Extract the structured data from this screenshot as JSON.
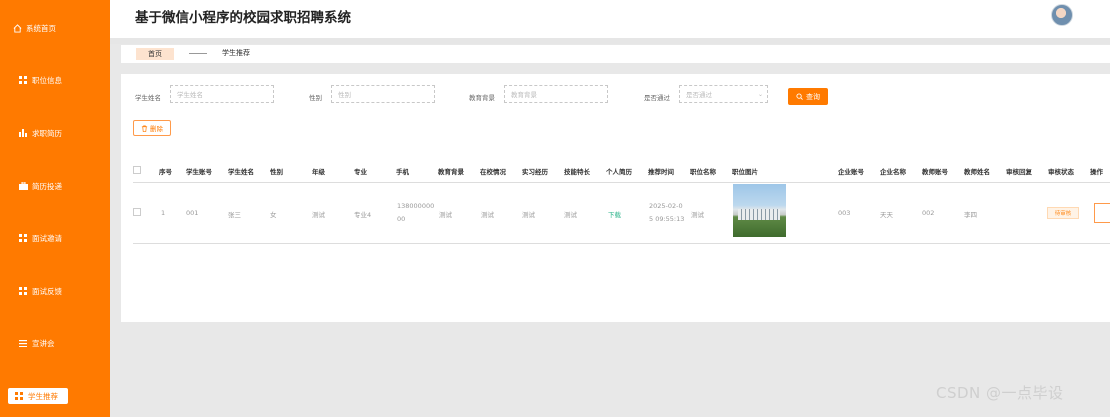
{
  "app": {
    "title": "基于微信小程序的校园求职招聘系统"
  },
  "sidebar": {
    "items": [
      {
        "label": "系统首页",
        "icon": "home-icon"
      },
      {
        "label": "职位信息",
        "icon": "grid-icon"
      },
      {
        "label": "求职简历",
        "icon": "bar-chart-icon"
      },
      {
        "label": "简历投递",
        "icon": "briefcase-icon"
      },
      {
        "label": "面试邀请",
        "icon": "grid-icon"
      },
      {
        "label": "面试反馈",
        "icon": "grid-icon"
      },
      {
        "label": "宣讲会",
        "icon": "list-icon"
      },
      {
        "label": "学生推荐",
        "icon": "grid-icon",
        "active": true
      }
    ]
  },
  "breadcrumb": {
    "home": "首页",
    "current": "学生推荐"
  },
  "search": {
    "fields": [
      {
        "label": "学生姓名",
        "placeholder": "学生姓名"
      },
      {
        "label": "性别",
        "placeholder": "性别"
      },
      {
        "label": "教育背景",
        "placeholder": "教育背景"
      },
      {
        "label": "是否通过",
        "placeholder": "是否通过"
      }
    ],
    "query_button": "查询",
    "delete_button": "删除"
  },
  "table": {
    "columns": [
      "序号",
      "学生账号",
      "学生姓名",
      "性别",
      "年级",
      "专业",
      "手机",
      "教育背景",
      "在校情况",
      "实习经历",
      "技能特长",
      "个人简历",
      "推荐时间",
      "职位名称",
      "职位图片",
      "企业账号",
      "企业名称",
      "教师账号",
      "教师姓名",
      "审核回复",
      "审核状态",
      "操作"
    ],
    "rows": [
      {
        "index": "1",
        "student_account": "001",
        "student_name": "张三",
        "gender": "女",
        "grade": "测试",
        "major": "专业4",
        "phone_l1": "138000000",
        "phone_l2": "00",
        "education": "测试",
        "campus": "测试",
        "internship": "测试",
        "skills": "测试",
        "resume": "下载",
        "time_l1": "2025-02-0",
        "time_l2": "5 09:55:13",
        "position": "测试",
        "company_account": "003",
        "company_name": "天天",
        "teacher_account": "002",
        "teacher_name": "李四",
        "review_reply": "",
        "review_status": "待审核"
      }
    ]
  },
  "watermark": "CSDN @一点毕设",
  "colors": {
    "accent": "#ff7a00",
    "link": "#2bb38a"
  }
}
